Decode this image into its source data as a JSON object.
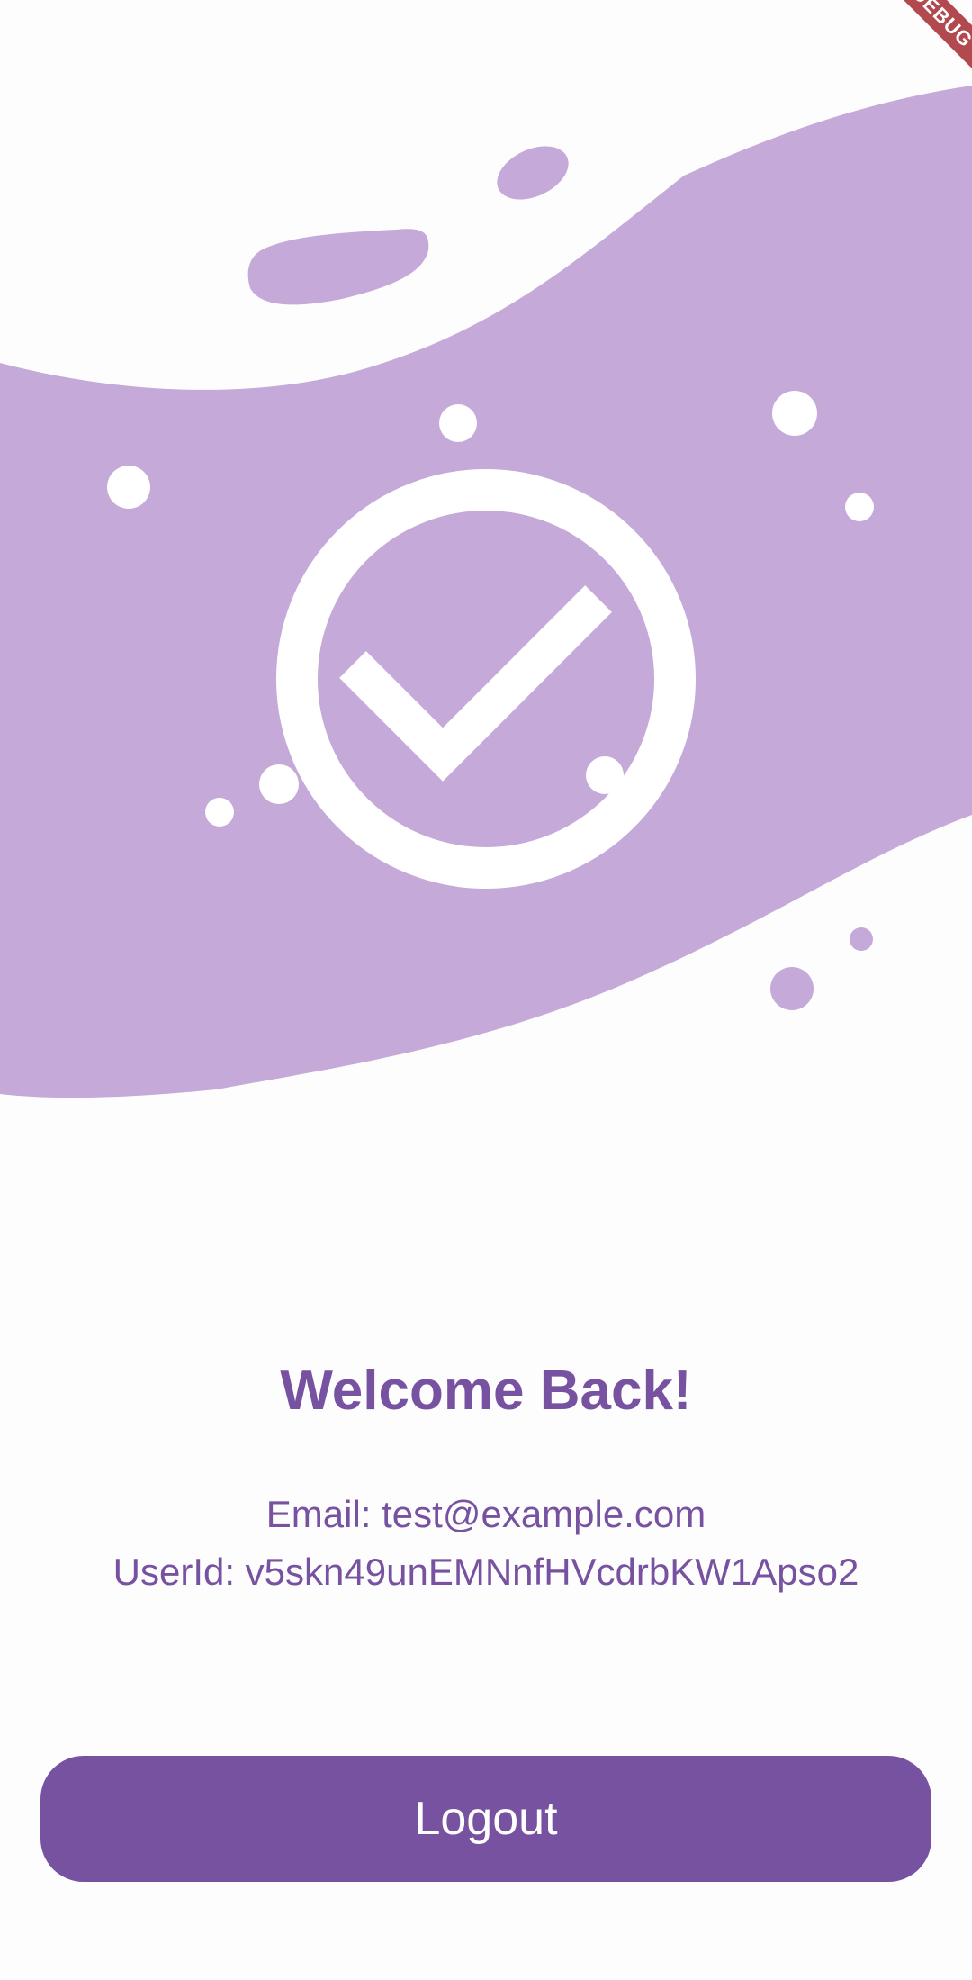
{
  "debug_banner": {
    "label": "DEBUG"
  },
  "welcome": {
    "title": "Welcome Back!"
  },
  "user": {
    "email_line": "Email: test@example.com",
    "userid_line": "UserId: v5skn49unEMNnfHVcdrbKW1Apso2"
  },
  "logout_button": {
    "label": "Logout"
  },
  "colors": {
    "primary": "#7752a0",
    "illustration_fill": "#c4a9d9",
    "background": "#fefdfe",
    "debug_banner": "#b2494e"
  },
  "icons": {
    "illustration": "success-check-circle-icon"
  }
}
